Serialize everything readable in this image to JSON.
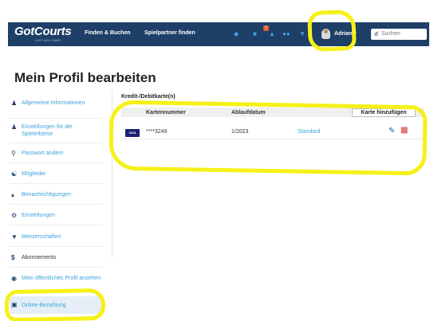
{
  "brand": {
    "logo": "GotCourts",
    "tagline": "JUST ADD GAME"
  },
  "nav": {
    "links": [
      "Finden & Buchen",
      "Spielpartner finden"
    ],
    "notification_count": "1",
    "user": "Adrian",
    "search_placeholder": "Suchen"
  },
  "page": {
    "title": "Mein Profil bearbeiten"
  },
  "sidebar": {
    "items": [
      {
        "label": "Allgemeine Informationen",
        "icon": "user-icon"
      },
      {
        "label": "Einstellungen für die Spielerbörse",
        "icon": "users-icon"
      },
      {
        "label": "Passwort ändern",
        "icon": "key-icon"
      },
      {
        "label": "Mitglieder",
        "icon": "members-icon"
      },
      {
        "label": "Benachrichtigungen",
        "icon": "megaphone-icon"
      },
      {
        "label": "Einstellungen",
        "icon": "gear-icon"
      },
      {
        "label": "Meisterschaften",
        "icon": "trophy-icon"
      },
      {
        "label": "Abonnements",
        "icon": "dollar-icon"
      },
      {
        "label": "Mein öffentliches Profil ansehen",
        "icon": "eye-icon"
      },
      {
        "label": "Online-Bezahlung",
        "icon": "card-icon"
      }
    ]
  },
  "cards": {
    "section_title": "Kredit-/Debitkarte(n)",
    "columns": [
      "Kartennummer",
      "Ablaufdatum"
    ],
    "add_button": "Karte hinzufügen",
    "rows": [
      {
        "brand": "VISA",
        "number": "****3249",
        "expiry": "1/2023",
        "status": "Standard"
      }
    ]
  },
  "colors": {
    "nav": "#1d3f68",
    "accent": "#3ea2dd",
    "highlight": "#f6f018",
    "delete": "#d32f2f"
  }
}
